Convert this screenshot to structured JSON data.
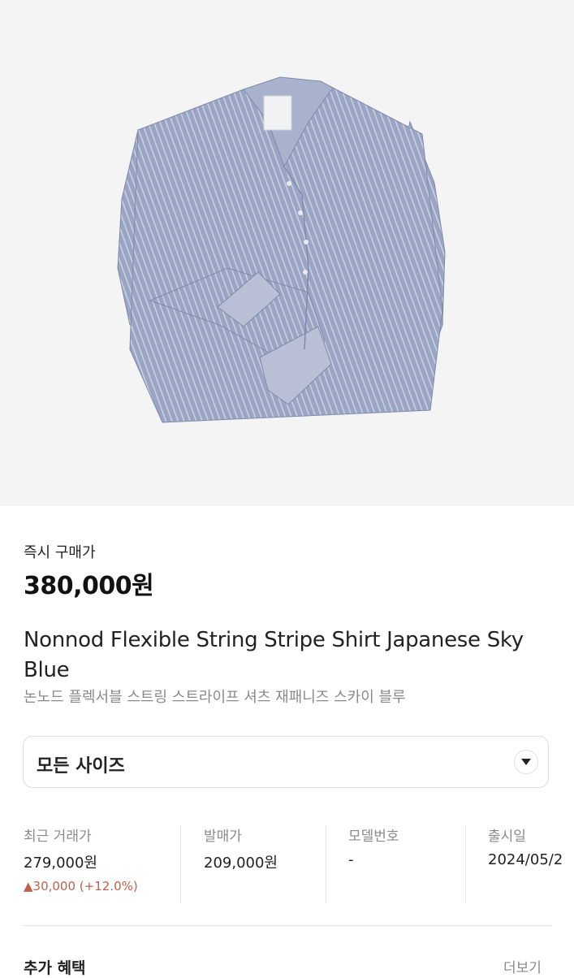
{
  "product": {
    "image_alt": "blue striped shirt",
    "buy_now_label": "즉시 구매가",
    "buy_now_price": "380,000원",
    "name_en": "Nonnod Flexible String Stripe Shirt Japanese Sky Blue",
    "name_ko": "논노드 플렉서블 스트링 스트라이프 셔츠 재패니즈 스카이 블루"
  },
  "size_selector": {
    "label": "모든 사이즈",
    "icon": "chevron-down-icon"
  },
  "info": {
    "recent_trade_label": "최근 거래가",
    "recent_trade_value": "279,000원",
    "recent_trade_change": "▲30,000 (+12.0%)",
    "release_price_label": "발매가",
    "release_price_value": "209,000원",
    "model_no_label": "모델번호",
    "model_no_value": "-",
    "release_date_label": "출시일",
    "release_date_value": "2024/05/2"
  },
  "benefits": {
    "title": "추가 혜택",
    "more_label": "더보기"
  },
  "colors": {
    "background": "#ffffff",
    "image_bg": "#f4f4f4",
    "change_up": "#c1604a",
    "muted_text": "#8a8a8a",
    "shirt": "#98a4c2"
  }
}
